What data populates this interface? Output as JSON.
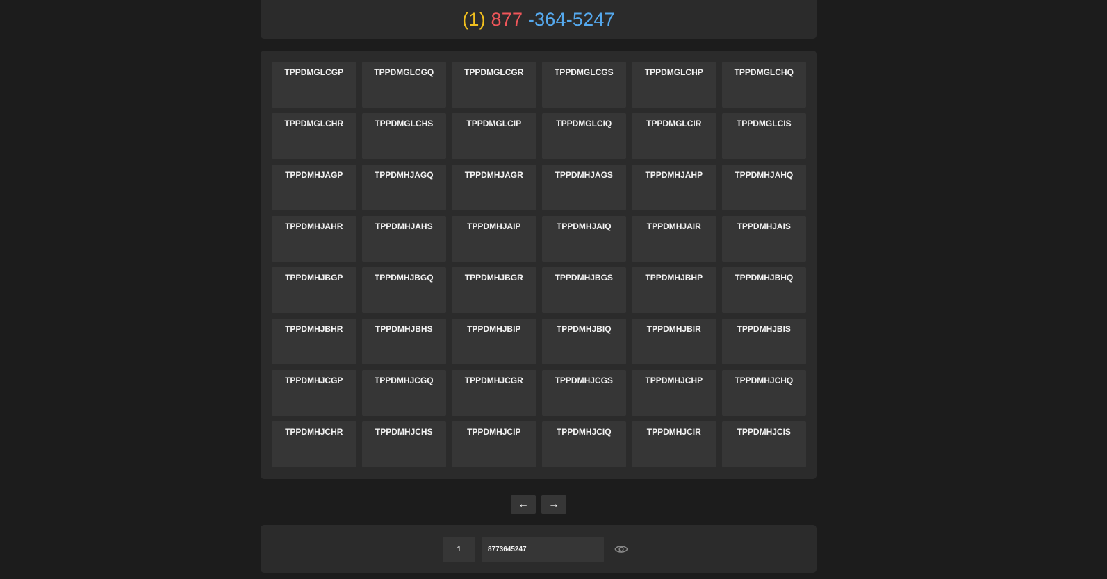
{
  "header": {
    "country_code": "(1)",
    "area_code": " 877",
    "rest": " -364-5247",
    "colors": {
      "country_code": "#f2c01e",
      "area_code": "#f0565a",
      "rest": "#55a9ee"
    }
  },
  "grid": {
    "cells": [
      "TPPDMGLCGP",
      "TPPDMGLCGQ",
      "TPPDMGLCGR",
      "TPPDMGLCGS",
      "TPPDMGLCHP",
      "TPPDMGLCHQ",
      "TPPDMGLCHR",
      "TPPDMGLCHS",
      "TPPDMGLCIP",
      "TPPDMGLCIQ",
      "TPPDMGLCIR",
      "TPPDMGLCIS",
      "TPPDMHJAGP",
      "TPPDMHJAGQ",
      "TPPDMHJAGR",
      "TPPDMHJAGS",
      "TPPDMHJAHP",
      "TPPDMHJAHQ",
      "TPPDMHJAHR",
      "TPPDMHJAHS",
      "TPPDMHJAIP",
      "TPPDMHJAIQ",
      "TPPDMHJAIR",
      "TPPDMHJAIS",
      "TPPDMHJBGP",
      "TPPDMHJBGQ",
      "TPPDMHJBGR",
      "TPPDMHJBGS",
      "TPPDMHJBHP",
      "TPPDMHJBHQ",
      "TPPDMHJBHR",
      "TPPDMHJBHS",
      "TPPDMHJBIP",
      "TPPDMHJBIQ",
      "TPPDMHJBIR",
      "TPPDMHJBIS",
      "TPPDMHJCGP",
      "TPPDMHJCGQ",
      "TPPDMHJCGR",
      "TPPDMHJCGS",
      "TPPDMHJCHP",
      "TPPDMHJCHQ",
      "TPPDMHJCHR",
      "TPPDMHJCHS",
      "TPPDMHJCIP",
      "TPPDMHJCIQ",
      "TPPDMHJCIR",
      "TPPDMHJCIS"
    ]
  },
  "pager": {
    "prev_label": "←",
    "next_label": "→"
  },
  "footer": {
    "page_number": "1",
    "phone_input_value": "8773645247",
    "visibility_icon": "eye-icon"
  }
}
